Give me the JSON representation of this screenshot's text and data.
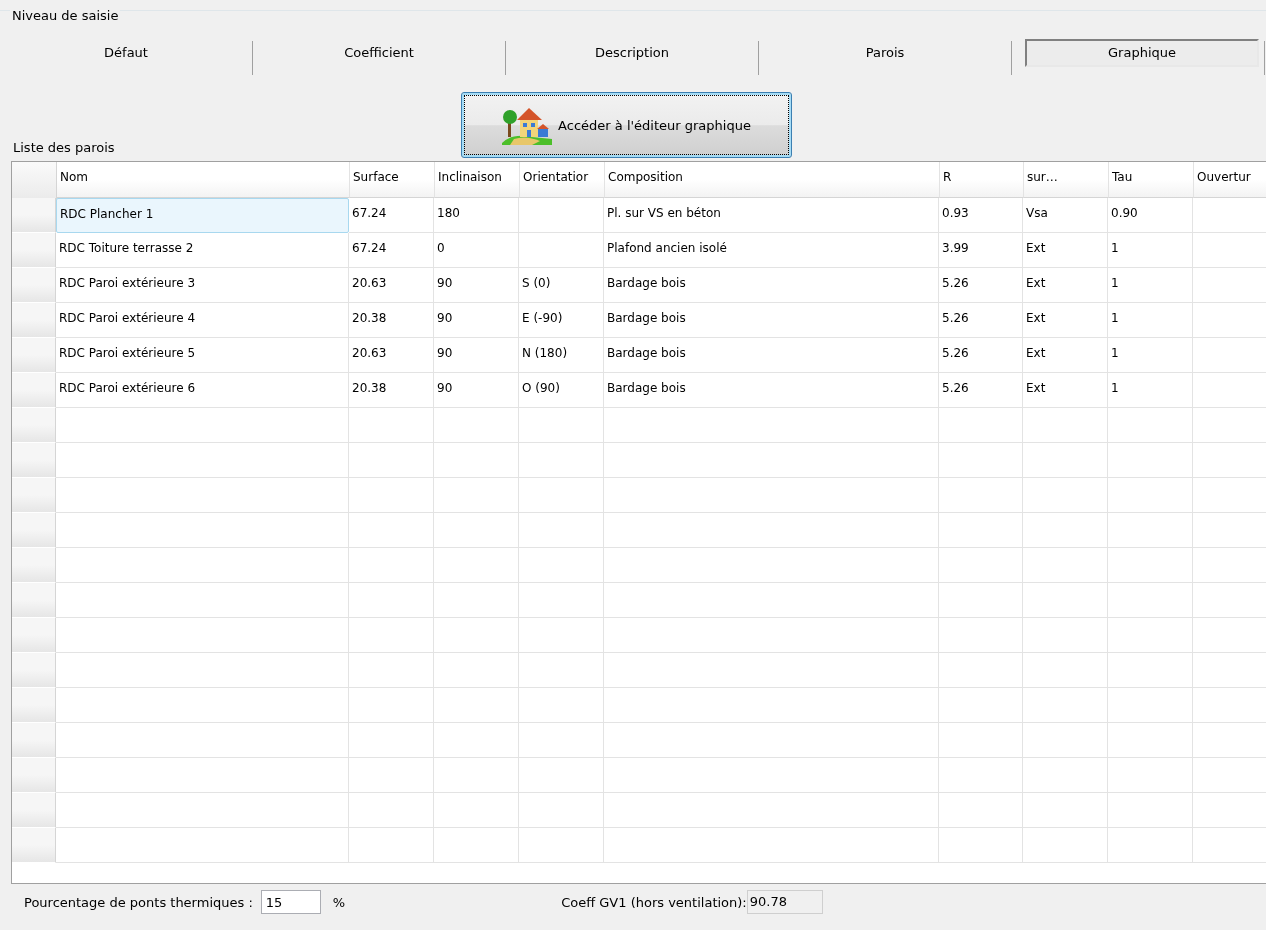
{
  "group_title": "Niveau de saisie",
  "tabs": [
    {
      "label": "Défaut",
      "selected": false
    },
    {
      "label": "Coefficient",
      "selected": false
    },
    {
      "label": "Description",
      "selected": false
    },
    {
      "label": "Parois",
      "selected": false
    },
    {
      "label": "Graphique",
      "selected": true
    }
  ],
  "editor_button": {
    "label": "Accéder à l'éditeur graphique"
  },
  "list_title": "Liste des parois",
  "table": {
    "columns": [
      "Nom",
      "Surface",
      "Inclinaison",
      "Orientatior",
      "Composition",
      "R",
      "sur…",
      "Tau",
      "Ouvertur"
    ],
    "rows": [
      {
        "selected": true,
        "cells": [
          "RDC Plancher 1",
          "67.24",
          "180",
          "",
          "Pl. sur VS en béton",
          "0.93",
          "Vsa",
          "0.90",
          ""
        ]
      },
      {
        "selected": false,
        "cells": [
          "RDC Toiture terrasse 2",
          "67.24",
          "0",
          "",
          "Plafond ancien isolé",
          "3.99",
          "Ext",
          "1",
          ""
        ]
      },
      {
        "selected": false,
        "cells": [
          "RDC Paroi extérieure 3",
          "20.63",
          "90",
          "S (0)",
          "Bardage bois",
          "5.26",
          "Ext",
          "1",
          ""
        ]
      },
      {
        "selected": false,
        "cells": [
          "RDC Paroi extérieure 4",
          "20.38",
          "90",
          "E (-90)",
          "Bardage bois",
          "5.26",
          "Ext",
          "1",
          ""
        ]
      },
      {
        "selected": false,
        "cells": [
          "RDC Paroi extérieure 5",
          "20.63",
          "90",
          "N (180)",
          "Bardage bois",
          "5.26",
          "Ext",
          "1",
          ""
        ]
      },
      {
        "selected": false,
        "cells": [
          "RDC Paroi extérieure 6",
          "20.38",
          "90",
          "O (90)",
          "Bardage bois",
          "5.26",
          "Ext",
          "1",
          ""
        ]
      }
    ]
  },
  "footer": {
    "bridges_label": "Pourcentage de ponts thermiques :",
    "bridges_value": "15",
    "bridges_unit": "%",
    "gv_label": "Coeff GV1 (hors ventilation):",
    "gv_value": "90.78"
  }
}
